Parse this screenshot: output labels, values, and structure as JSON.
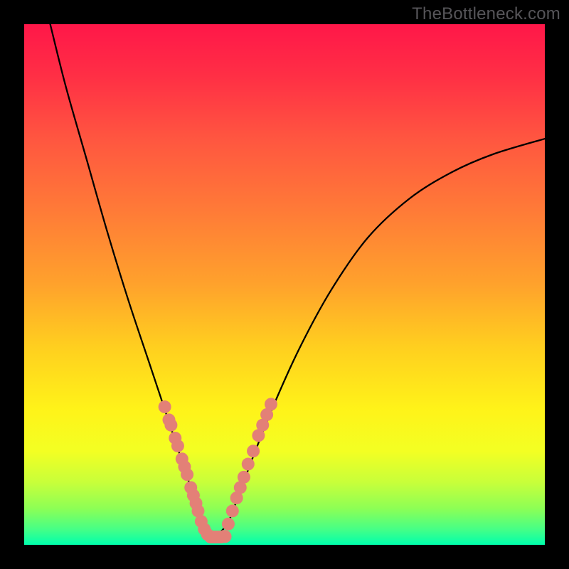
{
  "watermark": "TheBottleneck.com",
  "chart_data": {
    "type": "line",
    "title": "",
    "xlabel": "",
    "ylabel": "",
    "xlim": [
      0,
      100
    ],
    "ylim": [
      0,
      100
    ],
    "grid": false,
    "legend": false,
    "series": [
      {
        "name": "curve",
        "x": [
          5,
          8,
          12,
          16,
          20,
          24,
          27,
          29,
          31,
          33,
          34.5,
          35.5,
          36.5,
          39,
          41,
          44,
          48,
          53,
          59,
          66,
          74,
          82,
          90,
          100
        ],
        "y": [
          100,
          88,
          74,
          60,
          47,
          35,
          26,
          20,
          14,
          8,
          4,
          1.5,
          1.5,
          4,
          9,
          17,
          27,
          38,
          49,
          59,
          66.5,
          71.5,
          75,
          78
        ]
      }
    ],
    "markers": [
      {
        "name": "left-branch",
        "x": [
          27.0,
          27.8,
          28.2,
          29.0,
          29.5,
          30.3,
          30.8,
          31.3,
          32.0,
          32.5,
          33.0,
          33.4,
          34.0,
          34.6,
          35.2,
          35.8
        ],
        "y": [
          26.5,
          24.0,
          23.0,
          20.5,
          19.0,
          16.5,
          15.0,
          13.5,
          11.0,
          9.5,
          8.0,
          6.5,
          4.5,
          3.0,
          2.0,
          1.5
        ]
      },
      {
        "name": "valley",
        "x": [
          36.0,
          36.4,
          36.8,
          37.3,
          37.8,
          38.3,
          38.6
        ],
        "y": [
          1.5,
          1.5,
          1.5,
          1.5,
          1.5,
          1.6,
          1.6
        ]
      },
      {
        "name": "right-branch",
        "x": [
          39.2,
          40.0,
          40.8,
          41.5,
          42.2,
          43.0,
          44.0,
          45.0,
          45.8,
          46.6,
          47.4
        ],
        "y": [
          4.0,
          6.5,
          9.0,
          11.0,
          13.0,
          15.5,
          18.0,
          21.0,
          23.0,
          25.0,
          27.0
        ]
      }
    ],
    "marker_style": {
      "color": "#e38077",
      "radius_px": 9
    }
  }
}
